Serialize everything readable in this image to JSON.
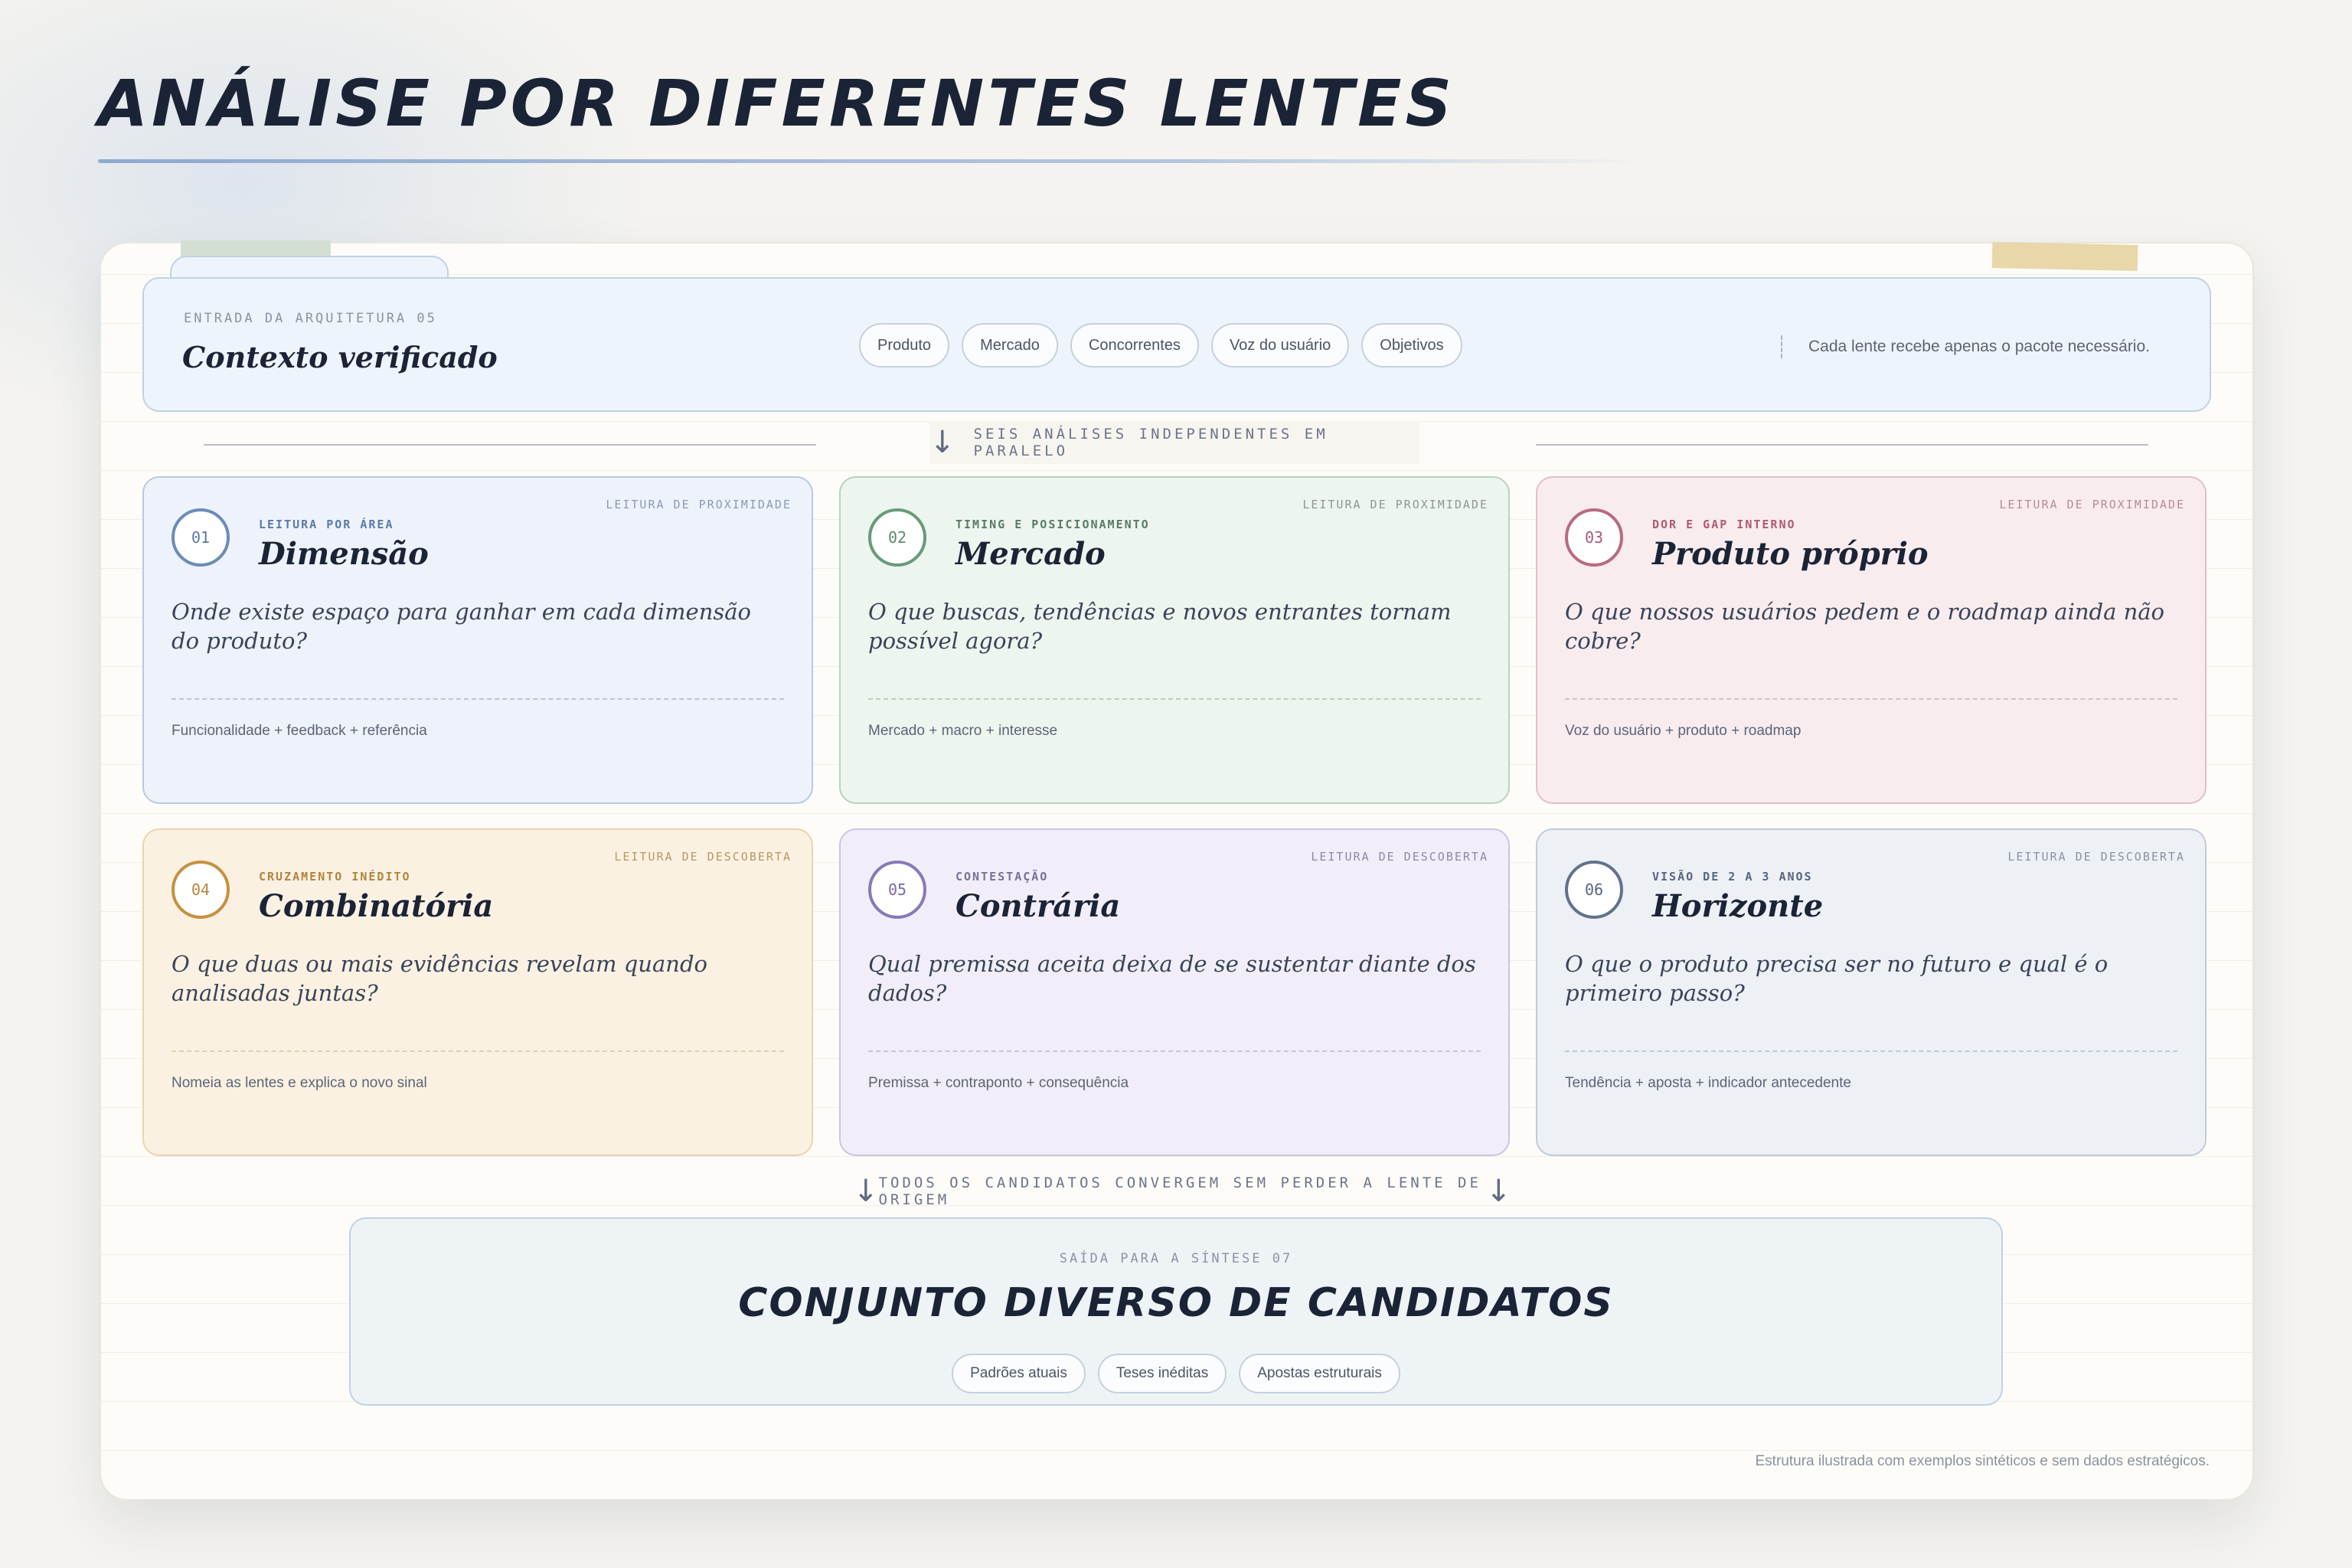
{
  "page": {
    "title": "ANÁLISE POR DIFERENTES LENTES"
  },
  "context": {
    "eyebrow": "ENTRADA DA ARQUITETURA 05",
    "title": "Contexto verificado",
    "chips": [
      "Produto",
      "Mercado",
      "Concorrentes",
      "Voz do usuário",
      "Objetivos"
    ],
    "note": "Cada lente recebe apenas o pacote necessário."
  },
  "parallel": {
    "label": "SEIS ANÁLISES INDEPENDENTES EM PARALELO",
    "arrow": "↓"
  },
  "cards": [
    {
      "number": "01",
      "kicker": "LEITURA POR ÁREA",
      "tag": "LEITURA DE PROXIMIDADE",
      "title": "Dimensão",
      "question": "Onde existe espaço para ganhar em cada dimensão do produto?",
      "sources": "Funcionalidade + feedback + referência"
    },
    {
      "number": "02",
      "kicker": "TIMING E POSICIONAMENTO",
      "tag": "LEITURA DE PROXIMIDADE",
      "title": "Mercado",
      "question": "O que buscas, tendências e novos entrantes tornam possível agora?",
      "sources": "Mercado + macro + interesse"
    },
    {
      "number": "03",
      "kicker": "DOR E GAP INTERNO",
      "tag": "LEITURA DE PROXIMIDADE",
      "title": "Produto próprio",
      "question": "O que nossos usuários pedem e o roadmap ainda não cobre?",
      "sources": "Voz do usuário + produto + roadmap"
    },
    {
      "number": "04",
      "kicker": "CRUZAMENTO INÉDITO",
      "tag": "LEITURA DE DESCOBERTA",
      "title": "Combinatória",
      "question": "O que duas ou mais evidências revelam quando analisadas juntas?",
      "sources": "Nomeia as lentes e explica o novo sinal"
    },
    {
      "number": "05",
      "kicker": "CONTESTAÇÃO",
      "tag": "LEITURA DE DESCOBERTA",
      "title": "Contrária",
      "question": "Qual premissa aceita deixa de se sustentar diante dos dados?",
      "sources": "Premissa + contraponto + consequência"
    },
    {
      "number": "06",
      "kicker": "VISÃO DE 2 A 3 ANOS",
      "tag": "LEITURA DE DESCOBERTA",
      "title": "Horizonte",
      "question": "O que o produto precisa ser no futuro e qual é o primeiro passo?",
      "sources": "Tendência + aposta + indicador antecedente"
    }
  ],
  "converge": {
    "label": "TODOS OS CANDIDATOS CONVERGEM SEM PERDER A LENTE DE ORIGEM",
    "arrow": "↓"
  },
  "output": {
    "eyebrow": "SAÍDA PARA A SÍNTESE 07",
    "title": "CONJUNTO DIVERSO DE CANDIDATOS",
    "chips": [
      "Padrões atuais",
      "Teses inéditas",
      "Apostas estruturais"
    ]
  },
  "footnote": "Estrutura ilustrada com exemplos sintéticos e sem dados estratégicos."
}
